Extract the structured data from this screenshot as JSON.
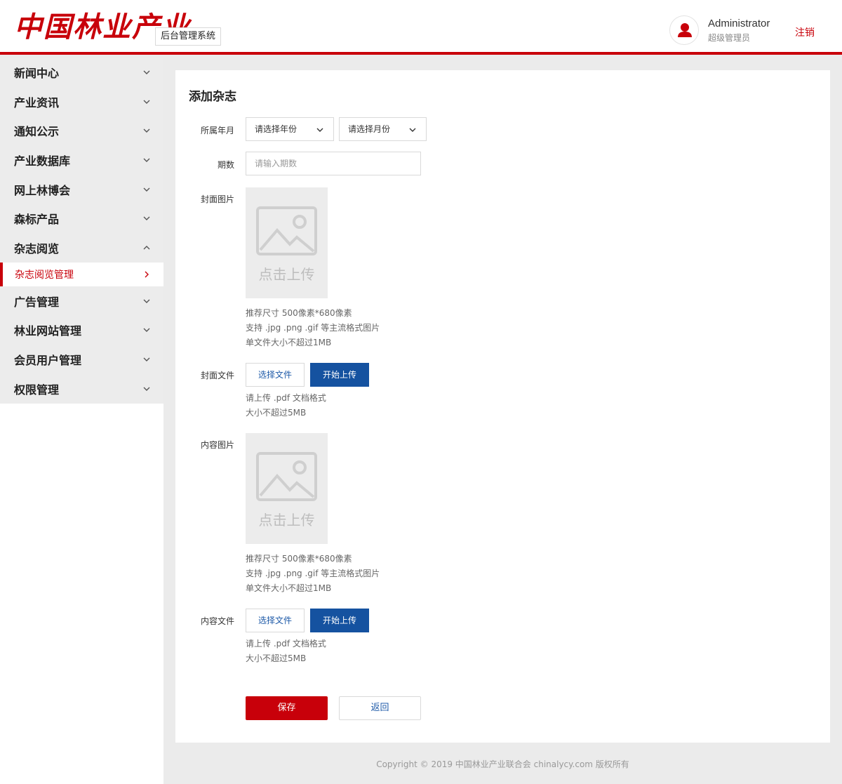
{
  "header": {
    "logo_text": "中国林业产业",
    "subsystem": "后台管理系统",
    "user_name": "Administrator",
    "user_role": "超级管理员",
    "logout": "注销"
  },
  "sidebar": {
    "items": [
      {
        "label": "新闻中心",
        "expanded": false
      },
      {
        "label": "产业资讯",
        "expanded": false
      },
      {
        "label": "通知公示",
        "expanded": false
      },
      {
        "label": "产业数据库",
        "expanded": false
      },
      {
        "label": "网上林博会",
        "expanded": false
      },
      {
        "label": "森标产品",
        "expanded": false
      },
      {
        "label": "杂志阅览",
        "expanded": true
      },
      {
        "label": "广告管理",
        "expanded": false
      },
      {
        "label": "林业网站管理",
        "expanded": false
      },
      {
        "label": "会员用户管理",
        "expanded": false
      },
      {
        "label": "权限管理",
        "expanded": false
      }
    ],
    "active_sub": "杂志阅览管理"
  },
  "form": {
    "title": "添加杂志",
    "year_month_label": "所属年月",
    "year_placeholder": "请选择年份",
    "month_placeholder": "请选择月份",
    "issue_label": "期数",
    "issue_placeholder": "请输入期数",
    "cover_image_label": "封面图片",
    "upload_text": "点击上传",
    "image_hints": [
      "推荐尺寸 500像素*680像素",
      "支持 .jpg .png .gif 等主流格式图片",
      "单文件大小不超过1MB"
    ],
    "cover_file_label": "封面文件",
    "choose_file": "选择文件",
    "start_upload": "开始上传",
    "file_hints": [
      "请上传 .pdf 文档格式",
      "大小不超过5MB"
    ],
    "content_image_label": "内容图片",
    "content_file_label": "内容文件",
    "save": "保存",
    "back": "返回"
  },
  "footer": "Copyright © 2019 中国林业产业联合会 chinalycy.com 版权所有",
  "colors": {
    "brand_red": "#c8000a",
    "primary_blue": "#1552a0",
    "link_blue": "#1e5aa8"
  }
}
